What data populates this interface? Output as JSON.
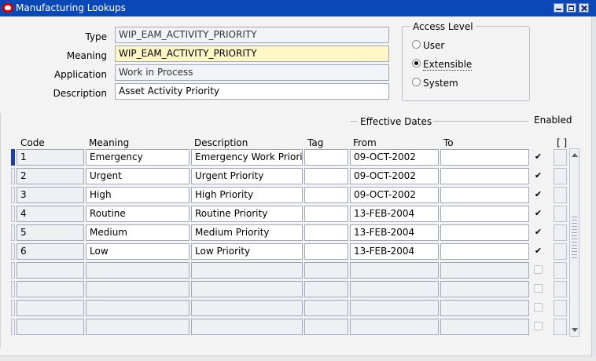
{
  "window": {
    "title": "Manufacturing Lookups"
  },
  "header": {
    "type_label": "Type",
    "type_value": "WIP_EAM_ACTIVITY_PRIORITY",
    "meaning_label": "Meaning",
    "meaning_value": "WIP_EAM_ACTIVITY_PRIORITY",
    "application_label": "Application",
    "application_value": "Work in Process",
    "description_label": "Description",
    "description_value": "Asset Activity Priority"
  },
  "access_level": {
    "title": "Access Level",
    "options": [
      {
        "label": "User",
        "selected": false
      },
      {
        "label": "Extensible",
        "selected": true
      },
      {
        "label": "System",
        "selected": false
      }
    ]
  },
  "table": {
    "effective_dates_label": "Effective Dates",
    "enabled_label": "Enabled",
    "bracket_label": "[ ]",
    "columns": {
      "code": "Code",
      "meaning": "Meaning",
      "description": "Description",
      "tag": "Tag",
      "from": "From",
      "to": "To"
    },
    "rows": [
      {
        "code": "1",
        "meaning": "Emergency",
        "description": "Emergency Work Priori",
        "tag": "",
        "from": "09-OCT-2002",
        "to": "",
        "enabled": true
      },
      {
        "code": "2",
        "meaning": "Urgent",
        "description": "Urgent Priority",
        "tag": "",
        "from": "09-OCT-2002",
        "to": "",
        "enabled": true
      },
      {
        "code": "3",
        "meaning": "High",
        "description": "High Priority",
        "tag": "",
        "from": "09-OCT-2002",
        "to": "",
        "enabled": true
      },
      {
        "code": "4",
        "meaning": "Routine",
        "description": "Routine Priority",
        "tag": "",
        "from": "13-FEB-2004",
        "to": "",
        "enabled": true
      },
      {
        "code": "5",
        "meaning": "Medium",
        "description": "Medium Priority",
        "tag": "",
        "from": "13-FEB-2004",
        "to": "",
        "enabled": true
      },
      {
        "code": "6",
        "meaning": "Low",
        "description": "Low Priority",
        "tag": "",
        "from": "13-FEB-2004",
        "to": "",
        "enabled": true
      },
      {
        "code": "",
        "meaning": "",
        "description": "",
        "tag": "",
        "from": "",
        "to": "",
        "enabled": false
      },
      {
        "code": "",
        "meaning": "",
        "description": "",
        "tag": "",
        "from": "",
        "to": "",
        "enabled": false
      },
      {
        "code": "",
        "meaning": "",
        "description": "",
        "tag": "",
        "from": "",
        "to": "",
        "enabled": false
      },
      {
        "code": "",
        "meaning": "",
        "description": "",
        "tag": "",
        "from": "",
        "to": "",
        "enabled": false
      }
    ]
  },
  "icons": {
    "app_logo": "oracle-logo-icon",
    "check": "checkmark-icon"
  },
  "colors": {
    "titlebar": "#0b48b7",
    "required_field": "#fff7c6",
    "current_row": "#1d3fa8"
  }
}
